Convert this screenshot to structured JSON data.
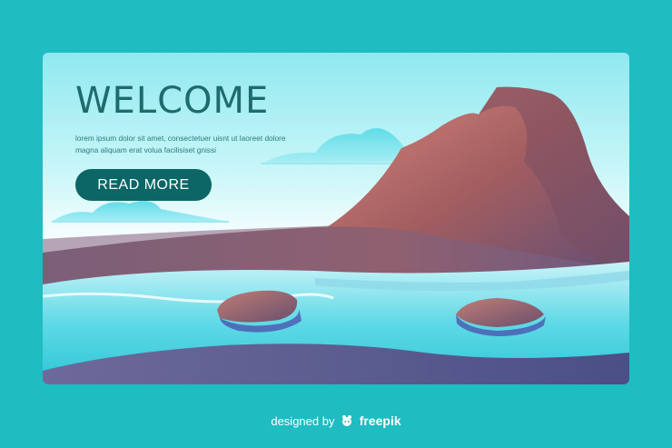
{
  "hero": {
    "title": "WELCOME",
    "body": "lorem ipsum dolor sit amet, consectetuer uisnt ut laoreet dolore magna aliquam erat volua facilisiset gnissi",
    "button_label": "READ MORE"
  },
  "footer": {
    "prefix": "designed by",
    "brand": "freepik",
    "logo_icon": "freepik-logo-icon"
  },
  "colors": {
    "page_background": "#1fbcc2",
    "title": "#1d6b6d",
    "button": "#0c6666",
    "mountain": "#9b5c5c"
  }
}
